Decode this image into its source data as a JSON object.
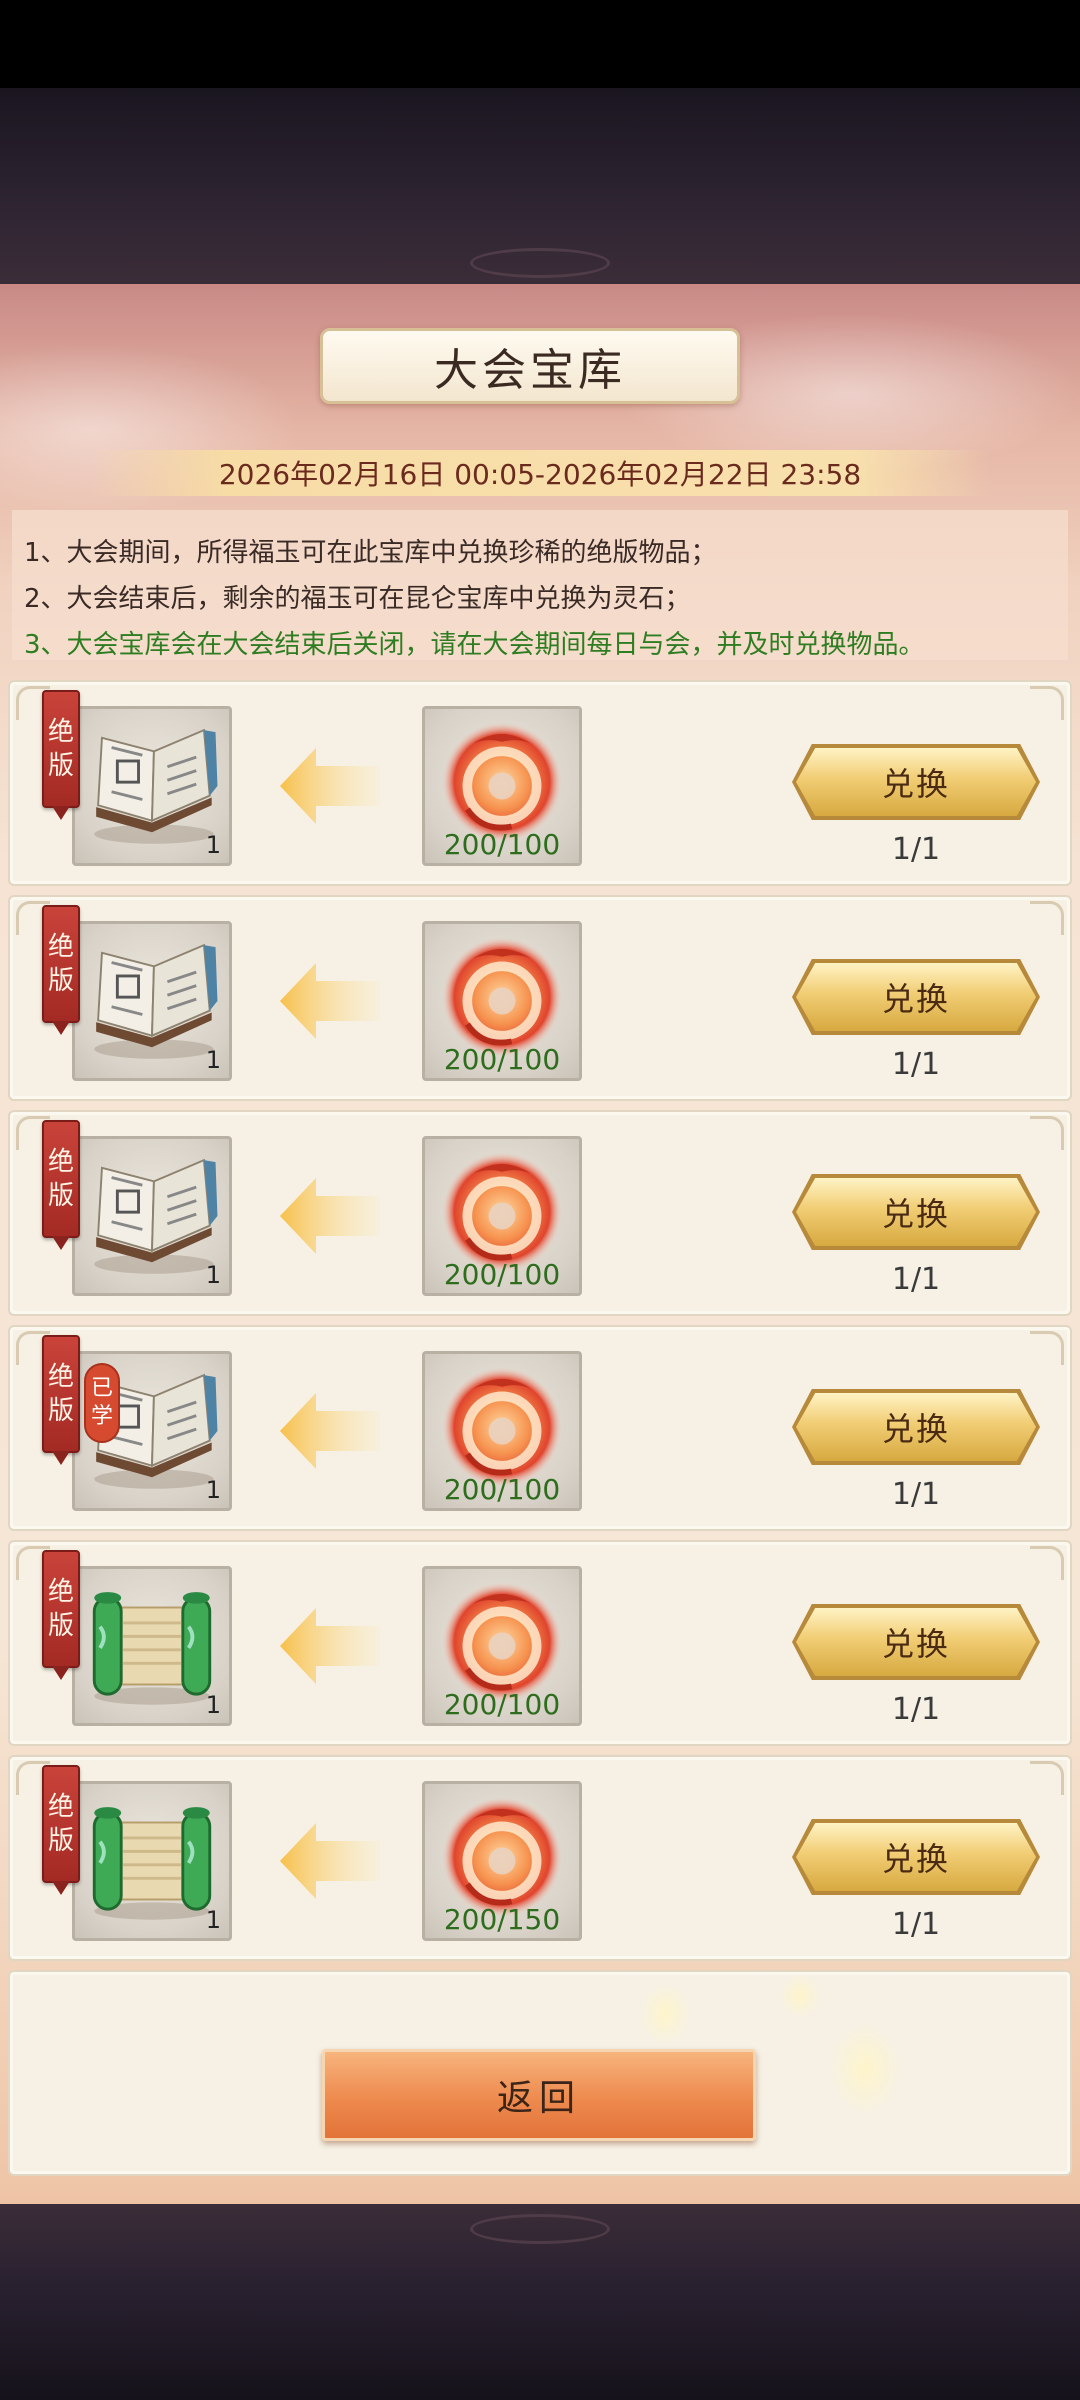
{
  "title": "大会宝库",
  "date_range": "2026年02月16日 00:05-2026年02月22日 23:58",
  "rules": [
    {
      "text": "1、大会期间，所得福玉可在此宝库中兑换珍稀的绝版物品；",
      "highlight": false
    },
    {
      "text": "2、大会结束后，剩余的福玉可在昆仑宝库中兑换为灵石；",
      "highlight": false
    },
    {
      "text": "3、大会宝库会在大会结束后关闭，请在大会期间每日与会，并及时兑换物品。",
      "highlight": true
    }
  ],
  "badge_label": "绝版",
  "badge_chars": [
    "绝",
    "版"
  ],
  "learned_chars": [
    "已",
    "学"
  ],
  "exchange_label": "兑换",
  "back_label": "返回",
  "rows": [
    {
      "item_icon": "book-icon",
      "item_qty": "1",
      "learned": false,
      "cost_icon": "fuyu-jade-icon",
      "cost_ratio": "200/100",
      "limit": "1/1"
    },
    {
      "item_icon": "book-icon",
      "item_qty": "1",
      "learned": false,
      "cost_icon": "fuyu-jade-icon",
      "cost_ratio": "200/100",
      "limit": "1/1"
    },
    {
      "item_icon": "book-icon",
      "item_qty": "1",
      "learned": false,
      "cost_icon": "fuyu-jade-icon",
      "cost_ratio": "200/100",
      "limit": "1/1"
    },
    {
      "item_icon": "book-icon",
      "item_qty": "1",
      "learned": true,
      "cost_icon": "fuyu-jade-icon",
      "cost_ratio": "200/100",
      "limit": "1/1"
    },
    {
      "item_icon": "scroll-icon",
      "item_qty": "1",
      "learned": false,
      "cost_icon": "fuyu-jade-icon",
      "cost_ratio": "200/100",
      "limit": "1/1"
    },
    {
      "item_icon": "scroll-icon",
      "item_qty": "1",
      "learned": false,
      "cost_icon": "fuyu-jade-icon",
      "cost_ratio": "200/150",
      "limit": "1/1"
    }
  ],
  "colors": {
    "ratio_green": "#2f6d1e",
    "rule_highlight": "#2f7d22",
    "badge_red": "#b5332c",
    "button_gold": "#f1cd74",
    "back_orange": "#ee8a4e"
  }
}
